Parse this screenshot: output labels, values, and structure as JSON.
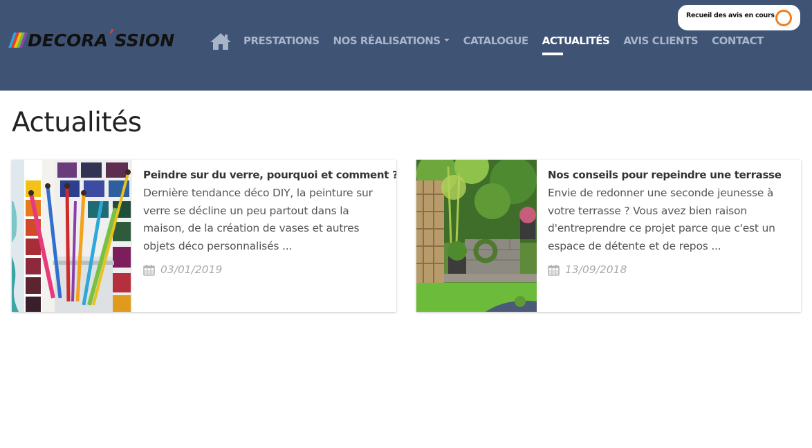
{
  "brand": {
    "logo_main": "DECORA",
    "logo_accent": "’",
    "logo_end": "SSION",
    "stripe_colors": [
      "#2aa7df",
      "#e53d2f",
      "#f4c20d",
      "#6fbf44",
      "#8e44ad"
    ]
  },
  "nav": {
    "home_icon": "home-icon",
    "items": [
      {
        "label": "PRESTATIONS"
      },
      {
        "label": "NOS RÉALISATIONS",
        "has_dropdown": true
      },
      {
        "label": "CATALOGUE"
      },
      {
        "label": "ACTUALITÉS",
        "active": true
      },
      {
        "label": "AVIS CLIENTS"
      },
      {
        "label": "CONTACT"
      }
    ]
  },
  "review_badge": {
    "text": "Recueil des avis en cours",
    "icon": "review-ring-icon",
    "ring_color": "#f07f21"
  },
  "page": {
    "title": "Actualités"
  },
  "articles": [
    {
      "title": "Peindre sur du verre, pourquoi et comment ?",
      "excerpt": "Dernière tendance déco DIY, la peinture sur verre se décline un peu partout dans la maison, de la création de vases et autres objets déco personnalisés ...",
      "date": "03/01/2019",
      "date_icon": "calendar-icon",
      "image": "paintbrushes-and-watercolor-palette"
    },
    {
      "title": "Nos conseils pour repeindre une terrasse",
      "excerpt": "Envie de redonner une seconde jeunesse à votre terrasse ? Vous avez bien raison d'entreprendre ce projet parce que c'est un espace de détente et de repos ...",
      "date": "13/09/2018",
      "date_icon": "calendar-icon",
      "image": "garden-terrace-with-plants"
    }
  ],
  "colors": {
    "header_bg": "#3f5375",
    "nav_text": "#a8b4c8",
    "nav_active": "#ffffff"
  }
}
